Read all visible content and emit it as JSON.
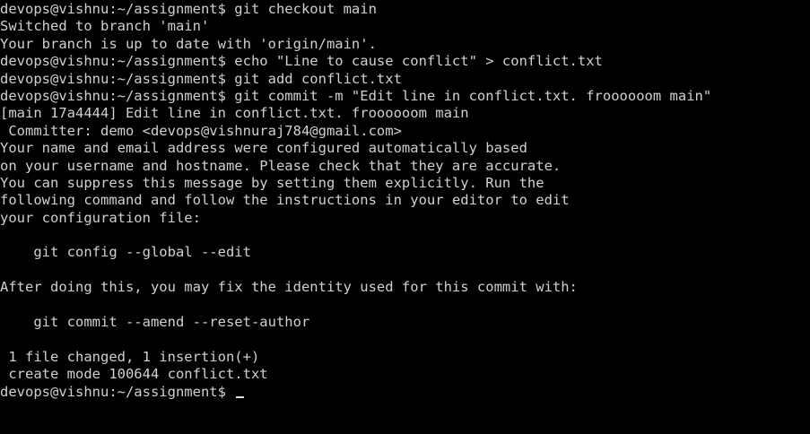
{
  "terminal": {
    "prompt": "devops@vishnu:~/assignment$",
    "lines": [
      "devops@vishnu:~/assignment$ git checkout main",
      "Switched to branch 'main'",
      "Your branch is up to date with 'origin/main'.",
      "devops@vishnu:~/assignment$ echo \"Line to cause conflict\" > conflict.txt",
      "devops@vishnu:~/assignment$ git add conflict.txt",
      "devops@vishnu:~/assignment$ git commit -m \"Edit line in conflict.txt. froooooom main\"",
      "[main 17a4444] Edit line in conflict.txt. froooooom main",
      " Committer: demo <devops@vishnuraj784@gmail.com>",
      "Your name and email address were configured automatically based",
      "on your username and hostname. Please check that they are accurate.",
      "You can suppress this message by setting them explicitly. Run the",
      "following command and follow the instructions in your editor to edit",
      "your configuration file:",
      "",
      "    git config --global --edit",
      "",
      "After doing this, you may fix the identity used for this commit with:",
      "",
      "    git commit --amend --reset-author",
      "",
      " 1 file changed, 1 insertion(+)",
      " create mode 100644 conflict.txt"
    ]
  },
  "colors": {
    "background": "#000000",
    "foreground": "#d0d0d0"
  }
}
